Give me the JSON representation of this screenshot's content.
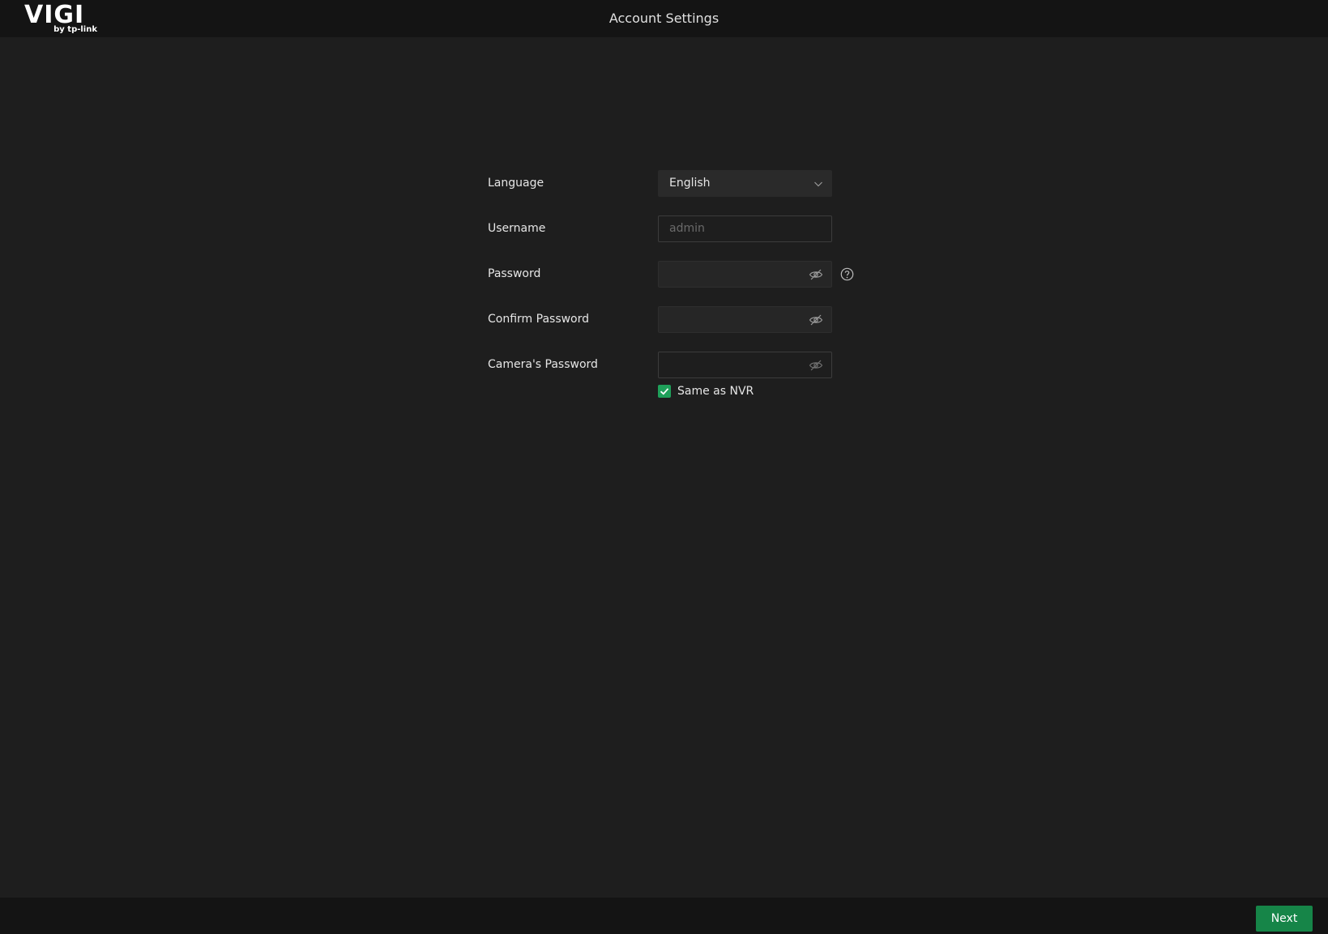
{
  "header": {
    "logo_text": "VIGI",
    "logo_subtext": "by tp-link",
    "title": "Account Settings"
  },
  "form": {
    "language": {
      "label": "Language",
      "value": "English",
      "icon": "chevron-down-icon"
    },
    "username": {
      "label": "Username",
      "placeholder": "admin",
      "value": ""
    },
    "password": {
      "label": "Password",
      "value": "",
      "icon": "eye-slash-icon",
      "help_icon": "question-circle-icon"
    },
    "confirm_password": {
      "label": "Confirm Password",
      "value": "",
      "icon": "eye-slash-icon"
    },
    "camera_password": {
      "label": "Camera's Password",
      "value": "",
      "icon": "eye-slash-icon"
    },
    "same_as_nvr": {
      "label": "Same as NVR",
      "checked": true
    }
  },
  "footer": {
    "next_label": "Next"
  },
  "colors": {
    "accent": "#168548",
    "checkbox": "#1fa05a",
    "background": "#1e1e1e",
    "bar": "#141414"
  }
}
